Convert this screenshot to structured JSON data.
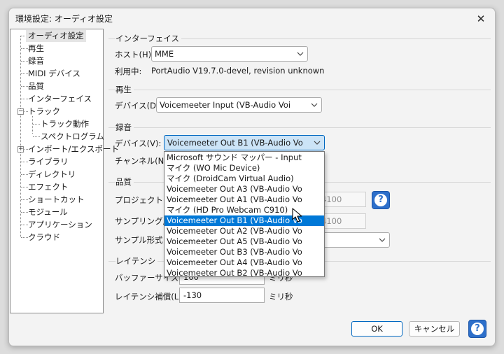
{
  "window": {
    "title": "環境設定: オーディオ設定",
    "close_glyph": "✕"
  },
  "tree": {
    "items": [
      "オーディオ設定",
      "再生",
      "録音",
      "MIDI デバイス",
      "品質",
      "インターフェイス",
      "トラック",
      "トラック動作",
      "スペクトログラム",
      "インポート/エクスポート",
      "ライブラリ",
      "ディレクトリ",
      "エフェクト",
      "ショートカット",
      "モジュール",
      "アプリケーション",
      "クラウド"
    ],
    "expander_minus": "−",
    "expander_plus": "+"
  },
  "interface": {
    "group": "インターフェイス",
    "host_label": "ホスト(H):",
    "host_value": "MME",
    "using_label": "利用中:",
    "using_value": "PortAudio V19.7.0-devel, revision unknown"
  },
  "playback": {
    "group": "再生",
    "device_label": "デバイス(D):",
    "device_value": "Voicemeeter Input (VB-Audio Voi"
  },
  "recording": {
    "group": "録音",
    "device_label": "デバイス(V):",
    "device_value": "Voicemeeter Out B1 (VB-Audio Vo",
    "channels_label": "チャンネル(N):"
  },
  "quality": {
    "group": "品質",
    "project_rate_label": "プロジェクトのサ",
    "project_rate_value": "4100",
    "sample_rate_label": "サンプリング周",
    "sample_rate_value": "4100",
    "sample_format_label": "サンプル形式"
  },
  "latency": {
    "group": "レイテンシ",
    "buffer_label": "バッファーサイズ(B):",
    "buffer_value": "100",
    "buffer_unit": "ミリ秒",
    "comp_label": "レイテンシ補償(L):",
    "comp_value": "-130",
    "comp_unit": "ミリ秒"
  },
  "dropdown": {
    "items": [
      "Microsoft サウンド マッパー - Input",
      "マイク (WO Mic Device)",
      "マイク (DroidCam Virtual Audio)",
      "Voicemeeter Out A3 (VB-Audio Vo",
      "Voicemeeter Out A1 (VB-Audio Vo",
      "マイク (HD Pro Webcam C910)",
      "Voicemeeter Out B1 (VB-Audio Vo",
      "Voicemeeter Out A2 (VB-Audio Vo",
      "Voicemeeter Out A5 (VB-Audio Vo",
      "Voicemeeter Out B3 (VB-Audio Vo",
      "Voicemeeter Out A4 (VB-Audio Vo",
      "Voicemeeter Out B2 (VB-Audio Vo"
    ],
    "highlighted_index": 6
  },
  "buttons": {
    "ok": "OK",
    "cancel": "キャンセル",
    "help_glyph": "?"
  },
  "colors": {
    "accent": "#0067c0",
    "highlight": "#0078d7",
    "help": "#2d6fca"
  }
}
